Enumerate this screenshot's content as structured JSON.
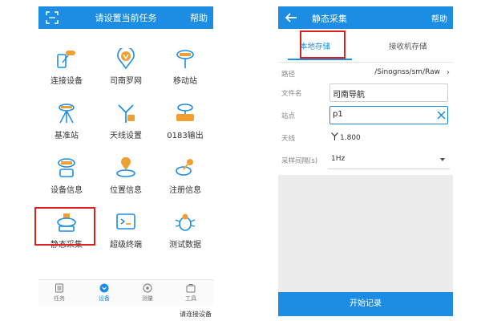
{
  "left_screen": {
    "header": {
      "title": "请设置当前任务",
      "help_label": "帮助"
    },
    "grid": [
      {
        "label": "连接设备",
        "icon": "connect-device-icon"
      },
      {
        "label": "司南罗网",
        "icon": "sinan-network-icon"
      },
      {
        "label": "移动站",
        "icon": "rover-icon"
      },
      {
        "label": "基准站",
        "icon": "base-station-icon"
      },
      {
        "label": "天线设置",
        "icon": "antenna-icon"
      },
      {
        "label": "0183输出",
        "icon": "nmea-icon"
      },
      {
        "label": "设备信息",
        "icon": "device-info-icon"
      },
      {
        "label": "位置信息",
        "icon": "location-icon"
      },
      {
        "label": "注册信息",
        "icon": "register-key-icon"
      },
      {
        "label": "静态采集",
        "icon": "static-collect-icon"
      },
      {
        "label": "超级终端",
        "icon": "terminal-icon"
      },
      {
        "label": "测试数据",
        "icon": "bug-icon"
      }
    ],
    "nav": [
      {
        "label": "任务",
        "icon": "task-icon"
      },
      {
        "label": "设备",
        "icon": "device-nav-icon"
      },
      {
        "label": "测量",
        "icon": "measure-icon"
      },
      {
        "label": "工具",
        "icon": "tools-icon"
      }
    ],
    "nav_active": "设备",
    "status_tip": "请连接设备"
  },
  "right_screen": {
    "header": {
      "title": "静态采集",
      "help_label": "帮助"
    },
    "tabs": {
      "local": "本地存储",
      "receiver": "接收机存储",
      "active": "本地存储"
    },
    "form": {
      "path_label": "路径",
      "path_value": "/Sinognss/sm/Raw",
      "filename_label": "文件名",
      "filename_value": "司南导航",
      "site_label": "站点",
      "site_value": "p1",
      "antenna_label": "天线",
      "antenna_value": "1.800",
      "interval_label": "采样间隔(s)",
      "interval_value": "1Hz"
    },
    "start_button_label": "开始记录"
  },
  "colors": {
    "primary": "#1c8de3",
    "highlight": "#e02020",
    "icon_orange": "#f0a030"
  }
}
